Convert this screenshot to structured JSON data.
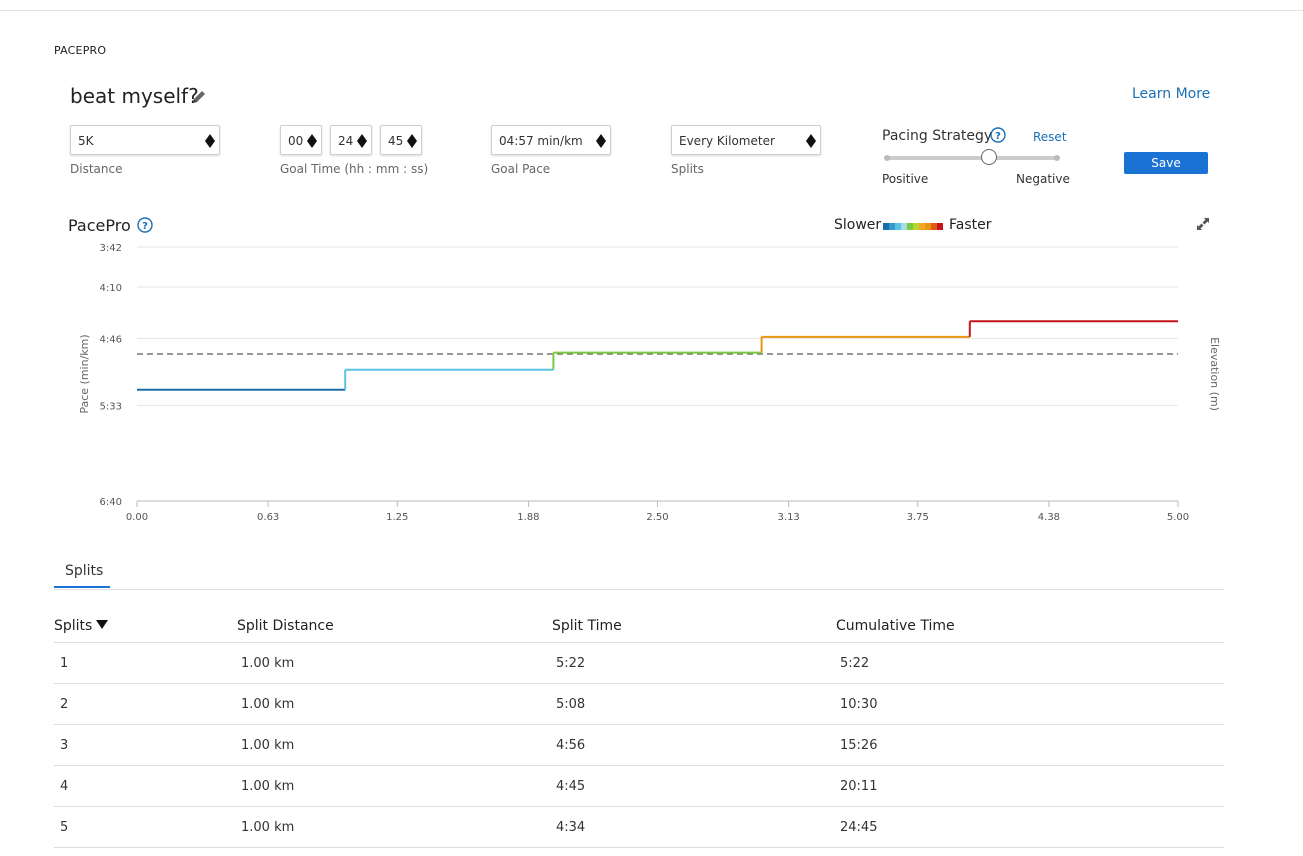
{
  "header": {
    "section": "PACEPRO",
    "plan_title": "beat myself?",
    "learn_more": "Learn More"
  },
  "form": {
    "distance": {
      "value": "5K",
      "label": "Distance"
    },
    "goal_time": {
      "hh": "00",
      "mm": "24",
      "ss": "45",
      "label": "Goal Time (hh : mm : ss)"
    },
    "goal_pace": {
      "value": "04:57 min/km",
      "label": "Goal Pace"
    },
    "splits": {
      "value": "Every Kilometer",
      "label": "Splits"
    },
    "pacing_strategy": {
      "label": "Pacing Strategy",
      "reset": "Reset",
      "left": "Positive",
      "right": "Negative",
      "level": 0.6
    },
    "save": "Save"
  },
  "chart_section": {
    "title": "PacePro",
    "legend_slower": "Slower",
    "legend_faster": "Faster"
  },
  "chart_data": {
    "type": "line",
    "ylabel": "Pace (min/km)",
    "y2label": "Elevation (m)",
    "yticks": [
      "3:42",
      "4:10",
      "4:46",
      "5:33",
      "6:40"
    ],
    "xticks": [
      "0.00",
      "0.63",
      "1.25",
      "1.88",
      "2.50",
      "3.13",
      "3.75",
      "4.38",
      "5.00"
    ],
    "xlim": [
      0,
      5
    ],
    "ylim_seconds_per_km": [
      222,
      400
    ],
    "goal_pace_seconds": 297,
    "series": [
      {
        "from": 0,
        "to": 1,
        "pace": "5:22",
        "color": "#1b6fa8"
      },
      {
        "from": 1,
        "to": 2,
        "pace": "5:08",
        "color": "#5bc3e0"
      },
      {
        "from": 2,
        "to": 3,
        "pace": "4:56",
        "color": "#7ac943"
      },
      {
        "from": 3,
        "to": 4,
        "pace": "4:45",
        "color": "#e8960f"
      },
      {
        "from": 4,
        "to": 5,
        "pace": "4:34",
        "color": "#c4161c"
      }
    ],
    "legend_colors": [
      "#1b6fa8",
      "#3399cc",
      "#5bc3e0",
      "#a8dde8",
      "#7ac943",
      "#b8d630",
      "#f5a623",
      "#e8960f",
      "#e05a1a",
      "#c4161c"
    ]
  },
  "splits_tab": "Splits",
  "table": {
    "headers": [
      "Splits",
      "Split Distance",
      "Split Time",
      "Cumulative Time"
    ],
    "rows": [
      [
        "1",
        "1.00 km",
        "5:22",
        "5:22"
      ],
      [
        "2",
        "1.00 km",
        "5:08",
        "10:30"
      ],
      [
        "3",
        "1.00 km",
        "4:56",
        "15:26"
      ],
      [
        "4",
        "1.00 km",
        "4:45",
        "20:11"
      ],
      [
        "5",
        "1.00 km",
        "4:34",
        "24:45"
      ]
    ]
  }
}
